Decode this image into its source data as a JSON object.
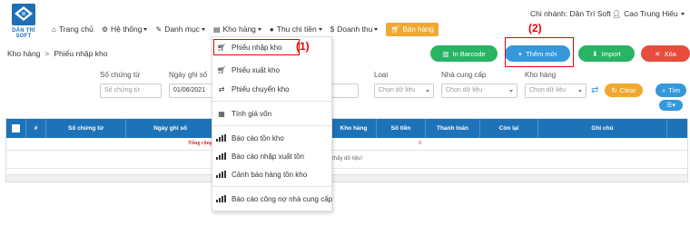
{
  "logo": {
    "text": "DÂN TRÍ SOFT"
  },
  "nav": {
    "items": [
      {
        "icon": "home-icon",
        "label": "Trang chủ"
      },
      {
        "icon": "gear-icon",
        "label": "Hệ thống"
      },
      {
        "icon": "wrench-icon",
        "label": "Danh mục"
      },
      {
        "icon": "warehouse-icon",
        "label": "Kho hàng"
      },
      {
        "icon": "coin-icon",
        "label": "Thu chi tiền"
      },
      {
        "icon": "dollar-icon",
        "label": "Doanh thu"
      }
    ],
    "sell_button": "Bán hàng"
  },
  "header": {
    "branch": "Chi nhánh: Dân Trí Soft",
    "user": "Cao Trung Hiếu"
  },
  "breadcrumb": {
    "root": "Kho hàng",
    "sep": ">",
    "current": "Phiếu nhập kho"
  },
  "actions": {
    "barcode": "In Barcode",
    "add": "Thêm mới",
    "import": "Import",
    "delete": "Xóa"
  },
  "annotations": {
    "one": "(1)",
    "two": "(2)"
  },
  "filters": {
    "voucher_label": "Số chứng từ",
    "voucher_placeholder": "Số chứng từ",
    "date_label": "Ngày ghi số",
    "date_value": "01/06/2021",
    "type_label": "Loại",
    "type_placeholder": "Chọn dữ liệu",
    "supplier_label": "Nhà cung cấp",
    "supplier_placeholder": "Chọn dữ liệu",
    "warehouse_label": "Kho hàng",
    "warehouse_placeholder": "Chọn dữ liệu",
    "clear": "Clear",
    "search": "Tìm"
  },
  "table": {
    "headers": [
      "#",
      "Số chứng từ",
      "Ngày ghi số",
      "Kho hàng",
      "Số tiền",
      "Thanh toán",
      "Còn lại",
      "Ghi chú"
    ],
    "sum_label": "Tổng cộng",
    "sum_value": "0",
    "empty": "Không tìm thấy dữ liệu!"
  },
  "dropdown": {
    "items": [
      {
        "icon": "cart-icon",
        "label": "Phiếu nhập kho"
      },
      {
        "icon": "cart-icon",
        "label": "Phiếu xuất kho"
      },
      {
        "icon": "transfer-icon",
        "label": "Phiếu chuyển kho"
      },
      {
        "icon": "calculator-icon",
        "label": "Tính giá vốn"
      },
      {
        "icon": "bar-chart-icon",
        "label": "Báo cáo tồn kho"
      },
      {
        "icon": "bar-chart-icon",
        "label": "Báo cáo nhập xuất tồn"
      },
      {
        "icon": "bar-chart-icon",
        "label": "Cảnh báo hàng tồn kho"
      },
      {
        "icon": "bar-chart-icon",
        "label": "Báo cáo công nợ nhà cung cấp"
      }
    ]
  },
  "colors": {
    "primary": "#1e73b8",
    "green": "#28b463",
    "blue": "#3498db",
    "red": "#e74c3c",
    "orange": "#f0a830",
    "annotation": "#e00000"
  }
}
